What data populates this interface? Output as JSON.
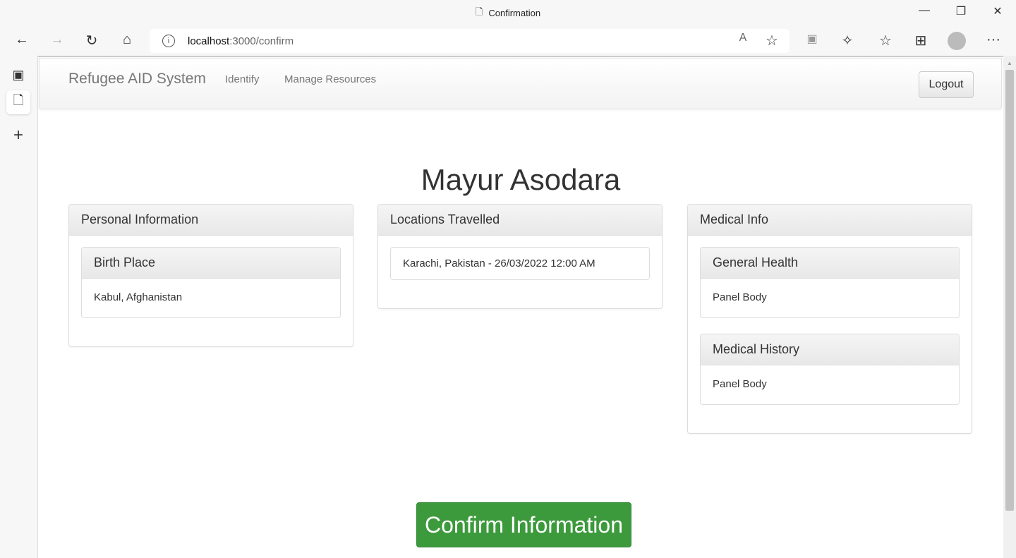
{
  "browser": {
    "tab_title": "Confirmation",
    "url_host": "localhost",
    "url_rest": ":3000/confirm",
    "icons": [
      "back-icon",
      "forward-icon",
      "refresh-icon",
      "home-icon",
      "info-icon",
      "read-aloud-icon",
      "add-favorite-icon",
      "extensions-icon",
      "favorites-icon",
      "collections-icon",
      "profile-icon",
      "more-icon"
    ]
  },
  "navbar": {
    "brand": "Refugee AID System",
    "links": [
      "Identify",
      "Manage Resources"
    ],
    "logout": "Logout"
  },
  "main": {
    "name": "Mayur Asodara",
    "personal": {
      "title": "Personal Information",
      "birth_place_title": "Birth Place",
      "birth_place": "Kabul, Afghanistan"
    },
    "locations": {
      "title": "Locations Travelled",
      "items": [
        "Karachi, Pakistan - 26/03/2022 12:00 AM"
      ]
    },
    "medical": {
      "title": "Medical Info",
      "general_title": "General Health",
      "general_body": "Panel Body",
      "history_title": "Medical History",
      "history_body": "Panel Body"
    },
    "confirm_label": "Confirm Information"
  },
  "colors": {
    "confirm": "#3c9a3c"
  }
}
